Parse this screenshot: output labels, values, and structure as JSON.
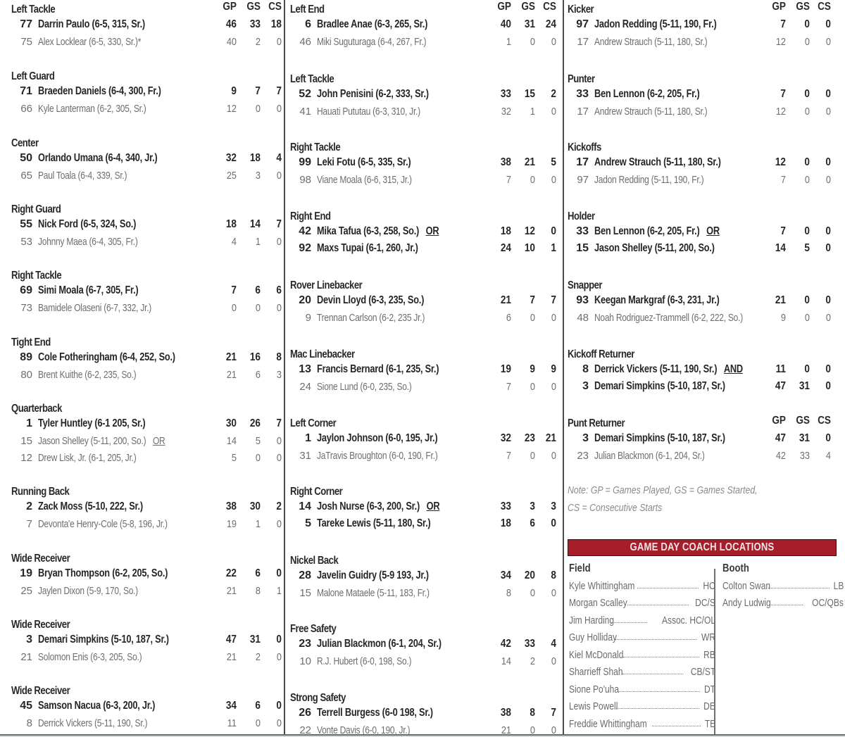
{
  "stat_headers": [
    "GP",
    "GS",
    "CS"
  ],
  "columns": [
    {
      "positions": [
        {
          "title": "Left Tackle",
          "show_headers": true,
          "players": [
            {
              "num": "77",
              "name": "Darrin Paulo (6-5, 315, Sr.)",
              "starter": true,
              "gp": "46",
              "gs": "33",
              "cs": "18"
            },
            {
              "num": "75",
              "name": "Alex Locklear (6-5, 330, Sr.)*",
              "starter": false,
              "gp": "40",
              "gs": "2",
              "cs": "0"
            }
          ]
        },
        {
          "title": "Left Guard",
          "players": [
            {
              "num": "71",
              "name": "Braeden Daniels (6-4, 300, Fr.)",
              "starter": true,
              "gp": "9",
              "gs": "7",
              "cs": "7"
            },
            {
              "num": "66",
              "name": "Kyle Lanterman (6-2, 305, Sr.)",
              "starter": false,
              "gp": "12",
              "gs": "0",
              "cs": "0"
            }
          ]
        },
        {
          "title": "Center",
          "players": [
            {
              "num": "50",
              "name": "Orlando Umana (6-4, 340, Jr.)",
              "starter": true,
              "gp": "32",
              "gs": "18",
              "cs": "4"
            },
            {
              "num": "65",
              "name": "Paul Toala (6-4, 339, Sr.)",
              "starter": false,
              "gp": "25",
              "gs": "3",
              "cs": "0"
            }
          ]
        },
        {
          "title": "Right Guard",
          "players": [
            {
              "num": "55",
              "name": "Nick Ford (6-5, 324, So.)",
              "starter": true,
              "gp": "18",
              "gs": "14",
              "cs": "7"
            },
            {
              "num": "53",
              "name": "Johnny Maea (6-4, 305, Fr.)",
              "starter": false,
              "gp": "4",
              "gs": "1",
              "cs": "0"
            }
          ]
        },
        {
          "title": "Right Tackle",
          "players": [
            {
              "num": "69",
              "name": "Simi Moala (6-7, 305, Fr.)",
              "starter": true,
              "gp": "7",
              "gs": "6",
              "cs": "6"
            },
            {
              "num": "73",
              "name": "Bamidele Olaseni (6-7, 332, Jr.)",
              "starter": false,
              "gp": "0",
              "gs": "0",
              "cs": "0"
            }
          ]
        },
        {
          "title": "Tight End",
          "players": [
            {
              "num": "89",
              "name": "Cole Fotheringham (6-4, 252, So.)",
              "starter": true,
              "gp": "21",
              "gs": "16",
              "cs": "8"
            },
            {
              "num": "80",
              "name": "Brent Kuithe (6-2, 235, So.)",
              "starter": false,
              "gp": "21",
              "gs": "6",
              "cs": "3"
            }
          ]
        },
        {
          "title": "Quarterback",
          "players": [
            {
              "num": "1",
              "name": "Tyler Huntley (6-1 205, Sr.)",
              "starter": true,
              "gp": "30",
              "gs": "26",
              "cs": "7"
            },
            {
              "num": "15",
              "name": "Jason Shelley (5-11, 200, So.)",
              "suffix": "OR",
              "starter": false,
              "gp": "14",
              "gs": "5",
              "cs": "0"
            },
            {
              "num": "12",
              "name": "Drew Lisk, Jr. (6-1, 205, Jr.)",
              "starter": false,
              "gp": "5",
              "gs": "0",
              "cs": "0"
            }
          ]
        },
        {
          "title": "Running Back",
          "players": [
            {
              "num": "2",
              "name": "Zack Moss (5-10, 222, Sr.)",
              "starter": true,
              "gp": "38",
              "gs": "30",
              "cs": "2"
            },
            {
              "num": "7",
              "name": "Devonta'e Henry-Cole (5-8, 196, Jr.)",
              "starter": false,
              "gp": "19",
              "gs": "1",
              "cs": "0"
            }
          ]
        },
        {
          "title": "Wide Receiver",
          "players": [
            {
              "num": "19",
              "name": "Bryan Thompson (6-2, 205, So.)",
              "starter": true,
              "gp": "22",
              "gs": "6",
              "cs": "0"
            },
            {
              "num": "25",
              "name": "Jaylen Dixon (5-9, 170, So.)",
              "starter": false,
              "gp": "21",
              "gs": "8",
              "cs": "1"
            }
          ]
        },
        {
          "title": "Wide Receiver",
          "players": [
            {
              "num": "3",
              "name": "Demari Simpkins (5-10, 187, Sr.)",
              "starter": true,
              "gp": "47",
              "gs": "31",
              "cs": "0"
            },
            {
              "num": "21",
              "name": "Solomon Enis (6-3, 205, So.)",
              "starter": false,
              "gp": "21",
              "gs": "2",
              "cs": "0"
            }
          ]
        },
        {
          "title": "Wide Receiver",
          "players": [
            {
              "num": "45",
              "name": "Samson Nacua (6-3, 200, Jr.)",
              "starter": true,
              "gp": "34",
              "gs": "6",
              "cs": "0"
            },
            {
              "num": "8",
              "name": "Derrick Vickers (5-11, 190, Sr.)",
              "starter": false,
              "gp": "11",
              "gs": "0",
              "cs": "0"
            }
          ]
        }
      ]
    },
    {
      "positions": [
        {
          "title": "Left End",
          "show_headers": true,
          "players": [
            {
              "num": "6",
              "name": "Bradlee Anae (6-3, 265, Sr.)",
              "starter": true,
              "gp": "40",
              "gs": "31",
              "cs": "24"
            },
            {
              "num": "46",
              "name": "Miki Suguturaga (6-4, 267, Fr.)",
              "starter": false,
              "gp": "1",
              "gs": "0",
              "cs": "0"
            }
          ]
        },
        {
          "title": "Left Tackle",
          "players": [
            {
              "num": "52",
              "name": "John Penisini (6-2, 333, Sr.)",
              "starter": true,
              "gp": "33",
              "gs": "15",
              "cs": "2"
            },
            {
              "num": "41",
              "name": "Hauati Pututau (6-3, 310, Jr.)",
              "starter": false,
              "gp": "32",
              "gs": "1",
              "cs": "0"
            }
          ]
        },
        {
          "title": "Right Tackle",
          "players": [
            {
              "num": "99",
              "name": "Leki Fotu (6-5, 335, Sr.)",
              "starter": true,
              "gp": "38",
              "gs": "21",
              "cs": "5"
            },
            {
              "num": "98",
              "name": "Viane Moala (6-6, 315, Jr.)",
              "starter": false,
              "gp": "7",
              "gs": "0",
              "cs": "0"
            }
          ]
        },
        {
          "title": "Right End",
          "players": [
            {
              "num": "42",
              "name": "Mika Tafua (6-3, 258, So.)",
              "suffix": "OR",
              "starter": true,
              "gp": "18",
              "gs": "12",
              "cs": "0"
            },
            {
              "num": "92",
              "name": "Maxs Tupai (6-1, 260, Jr.)",
              "starter": true,
              "gp": "24",
              "gs": "10",
              "cs": "1"
            }
          ]
        },
        {
          "title": "Rover Linebacker",
          "players": [
            {
              "num": "20",
              "name": "Devin Lloyd (6-3, 235, So.)",
              "starter": true,
              "gp": "21",
              "gs": "7",
              "cs": "7"
            },
            {
              "num": "9",
              "name": "Trennan Carlson (6-2, 235 Jr.)",
              "starter": false,
              "gp": "6",
              "gs": "0",
              "cs": "0"
            }
          ]
        },
        {
          "title": "Mac Linebacker",
          "players": [
            {
              "num": "13",
              "name": "Francis Bernard (6-1, 235, Sr.)",
              "starter": true,
              "gp": "19",
              "gs": "9",
              "cs": "9"
            },
            {
              "num": "24",
              "name": "Sione Lund (6-0, 235, So.)",
              "starter": false,
              "gp": "7",
              "gs": "0",
              "cs": "0"
            }
          ]
        },
        {
          "title": "Left Corner",
          "players": [
            {
              "num": "1",
              "name": "Jaylon Johnson (6-0, 195, Jr.)",
              "starter": true,
              "gp": "32",
              "gs": "23",
              "cs": "21"
            },
            {
              "num": "31",
              "name": "JaTravis Broughton (6-0, 190, Fr.)",
              "starter": false,
              "gp": "7",
              "gs": "0",
              "cs": "0"
            }
          ]
        },
        {
          "title": "Right Corner",
          "players": [
            {
              "num": "14",
              "name": "Josh Nurse (6-3, 200, Sr.)",
              "suffix": "OR",
              "starter": true,
              "gp": "33",
              "gs": "3",
              "cs": "3"
            },
            {
              "num": "5",
              "name": "Tareke Lewis (5-11, 180, Sr.)",
              "starter": true,
              "gp": "18",
              "gs": "6",
              "cs": "0"
            }
          ]
        },
        {
          "title": "Nickel Back",
          "players": [
            {
              "num": "28",
              "name": "Javelin Guidry (5-9 193, Jr.)",
              "starter": true,
              "gp": "34",
              "gs": "20",
              "cs": "8"
            },
            {
              "num": "15",
              "name": "Malone Mataele (5-11, 183, Fr.)",
              "starter": false,
              "gp": "8",
              "gs": "0",
              "cs": "0"
            }
          ]
        },
        {
          "title": "Free Safety",
          "players": [
            {
              "num": "23",
              "name": "Julian Blackmon (6-1, 204, Sr.)",
              "starter": true,
              "gp": "42",
              "gs": "33",
              "cs": "4"
            },
            {
              "num": "10",
              "name": "R.J. Hubert (6-0, 198, So.)",
              "starter": false,
              "gp": "14",
              "gs": "2",
              "cs": "0"
            }
          ]
        },
        {
          "title": "Strong Safety",
          "players": [
            {
              "num": "26",
              "name": "Terrell Burgess (6-0 198, Sr.)",
              "starter": true,
              "gp": "38",
              "gs": "8",
              "cs": "7"
            },
            {
              "num": "22",
              "name": "Vonte Davis (6-0, 190, Jr.)",
              "starter": false,
              "gp": "21",
              "gs": "0",
              "cs": "0"
            }
          ]
        }
      ]
    },
    {
      "positions": [
        {
          "title": "Kicker",
          "show_headers": true,
          "players": [
            {
              "num": "97",
              "name": "Jadon Redding (5-11, 190, Fr.)",
              "starter": true,
              "gp": "7",
              "gs": "0",
              "cs": "0"
            },
            {
              "num": "17",
              "name": "Andrew Strauch (5-11, 180, Sr.)",
              "starter": false,
              "gp": "12",
              "gs": "0",
              "cs": "0"
            }
          ]
        },
        {
          "title": "Punter",
          "players": [
            {
              "num": "33",
              "name": "Ben Lennon (6-2, 205, Fr.)",
              "starter": true,
              "gp": "7",
              "gs": "0",
              "cs": "0"
            },
            {
              "num": "17",
              "name": "Andrew Strauch (5-11, 180, Sr.)",
              "starter": false,
              "gp": "12",
              "gs": "0",
              "cs": "0"
            }
          ]
        },
        {
          "title": "Kickoffs",
          "players": [
            {
              "num": "17",
              "name": "Andrew Strauch (5-11, 180, Sr.)",
              "starter": true,
              "gp": "12",
              "gs": "0",
              "cs": "0"
            },
            {
              "num": "97",
              "name": "Jadon Redding (5-11, 190, Fr.)",
              "starter": false,
              "gp": "7",
              "gs": "0",
              "cs": "0"
            }
          ]
        },
        {
          "title": "Holder",
          "players": [
            {
              "num": "33",
              "name": "Ben Lennon (6-2, 205, Fr.)",
              "suffix": "OR",
              "starter": true,
              "gp": "7",
              "gs": "0",
              "cs": "0"
            },
            {
              "num": "15",
              "name": "Jason Shelley (5-11, 200, So.)",
              "starter": true,
              "gp": "14",
              "gs": "5",
              "cs": "0"
            }
          ]
        },
        {
          "title": "Snapper",
          "players": [
            {
              "num": "93",
              "name": "Keegan Markgraf (6-3, 231, Jr.)",
              "starter": true,
              "gp": "21",
              "gs": "0",
              "cs": "0"
            },
            {
              "num": "48",
              "name": "Noah Rodriguez-Trammell (6-2, 222, So.)",
              "starter": false,
              "gp": "9",
              "gs": "0",
              "cs": "0"
            }
          ]
        },
        {
          "title": "Kickoff Returner",
          "players": [
            {
              "num": "8",
              "name": "Derrick Vickers (5-11, 190, Sr.)",
              "suffix": "AND",
              "starter": true,
              "gp": "11",
              "gs": "0",
              "cs": "0"
            },
            {
              "num": "3",
              "name": "Demari Simpkins (5-10, 187, Sr.)",
              "starter": true,
              "gp": "47",
              "gs": "31",
              "cs": "0"
            }
          ]
        },
        {
          "title": "Punt Returner",
          "show_headers": true,
          "players": [
            {
              "num": "3",
              "name": "Demari Simpkins (5-10, 187, Sr.)",
              "starter": true,
              "gp": "47",
              "gs": "31",
              "cs": "0"
            },
            {
              "num": "23",
              "name": "Julian Blackmon (6-1, 204, Sr.)",
              "starter": false,
              "gp": "42",
              "gs": "33",
              "cs": "4"
            }
          ]
        }
      ]
    }
  ],
  "note": {
    "line1": "Note: GP = Games Played, GS = Games Started,",
    "line2": "CS = Consecutive Starts"
  },
  "coaches": {
    "banner": "GAME DAY COACH LOCATIONS",
    "banner_color": "#a61e2a",
    "field": {
      "title": "Field",
      "list": [
        {
          "name": "Kyle Whittingham",
          "role": "HC"
        },
        {
          "name": "Morgan Scalley",
          "role": "DC/S"
        },
        {
          "name": "Jim Harding",
          "role": "Assoc. HC/OL"
        },
        {
          "name": "Guy Holliday",
          "role": "WR"
        },
        {
          "name": "Kiel McDonald",
          "role": "RB"
        },
        {
          "name": "Sharrieff Shah",
          "role": "CB/ST"
        },
        {
          "name": "Sione Po'uha",
          "role": "DT"
        },
        {
          "name": "Lewis Powell",
          "role": "DE"
        },
        {
          "name": "Freddie Whittingham",
          "role": "TE"
        }
      ]
    },
    "booth": {
      "title": "Booth",
      "list": [
        {
          "name": "Colton Swan",
          "role": "LB"
        },
        {
          "name": "Andy Ludwig",
          "role": "OC/QBs"
        }
      ]
    }
  }
}
